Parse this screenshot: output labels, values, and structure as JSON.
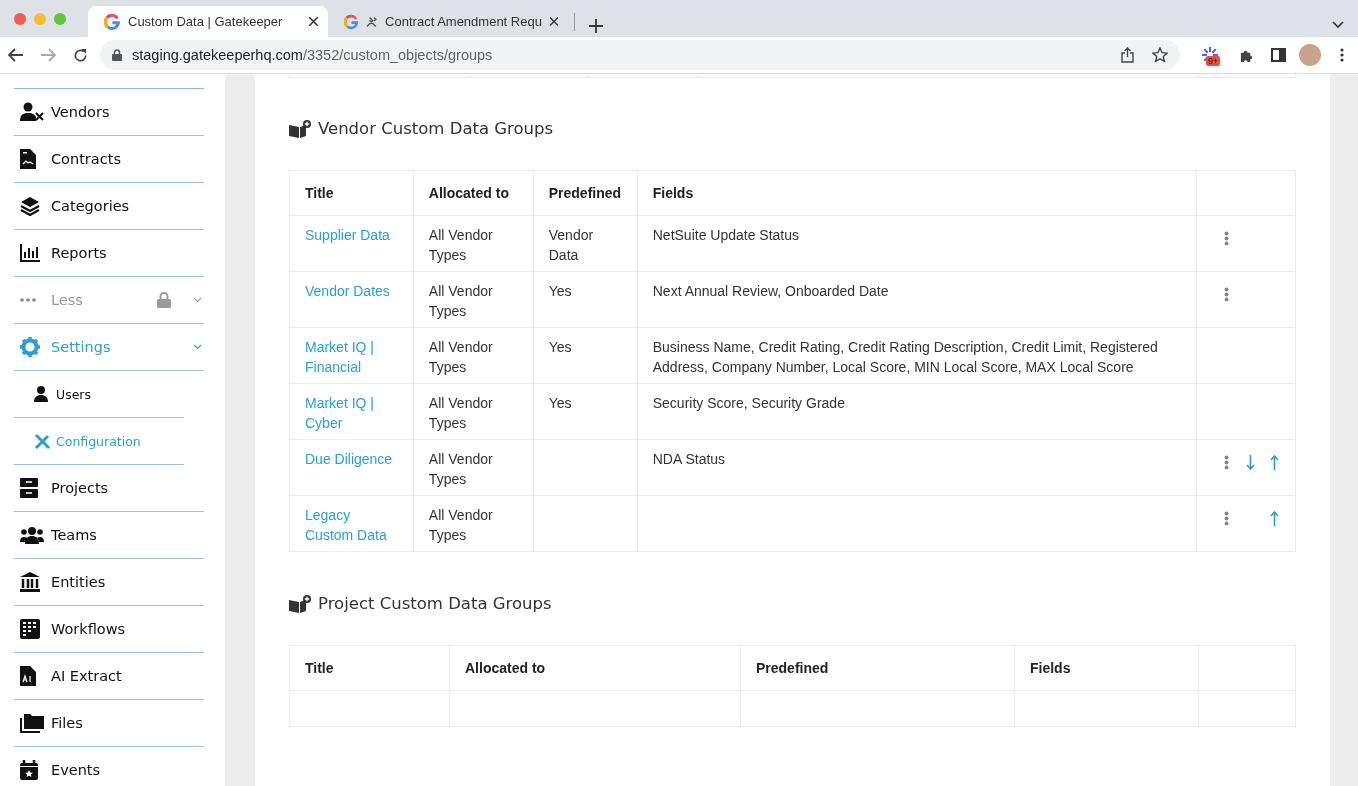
{
  "browser": {
    "tabs": [
      {
        "title": "Custom Data | Gatekeeper",
        "selected": true
      },
      {
        "title": "Contract Amendment Requ",
        "selected": false
      }
    ],
    "url": {
      "host": "staging.gatekeeperhq.com",
      "path": "/3352/custom_objects/groups"
    },
    "extension_badge": "9+"
  },
  "sidebar": {
    "items": [
      {
        "label": "Vendors",
        "kind": "link",
        "selected": false
      },
      {
        "label": "Contracts",
        "kind": "link",
        "selected": false
      },
      {
        "label": "Categories",
        "kind": "link",
        "selected": false
      },
      {
        "label": "Reports",
        "kind": "link",
        "selected": false
      },
      {
        "label": "Less",
        "kind": "group",
        "selected": false,
        "expanded": true,
        "locked": true
      },
      {
        "label": "Settings",
        "kind": "group",
        "selected": true,
        "expanded": true,
        "locked": false
      },
      {
        "label": "Users",
        "kind": "sub",
        "selected": false
      },
      {
        "label": "Configuration",
        "kind": "sub",
        "selected": true
      },
      {
        "label": "Projects",
        "kind": "link",
        "selected": false
      },
      {
        "label": "Teams",
        "kind": "link",
        "selected": false
      },
      {
        "label": "Entities",
        "kind": "link",
        "selected": false
      },
      {
        "label": "Workflows",
        "kind": "link",
        "selected": false
      },
      {
        "label": "AI Extract",
        "kind": "link",
        "selected": false
      },
      {
        "label": "Files",
        "kind": "link",
        "selected": false
      },
      {
        "label": "Events",
        "kind": "link",
        "selected": false
      }
    ]
  },
  "sections": [
    {
      "heading": "Vendor Custom Data Groups",
      "columns": [
        "Title",
        "Allocated to",
        "Predefined",
        "Fields"
      ],
      "rows": [
        {
          "title": "Supplier Data",
          "allocated_to": "All Vendor Types",
          "predefined": "Vendor Data",
          "fields": "NetSuite Update Status",
          "menu": true,
          "move_down": false,
          "move_up": false
        },
        {
          "title": "Vendor Dates",
          "allocated_to": "All Vendor Types",
          "predefined": "Yes",
          "fields": "Next Annual Review, Onboarded Date",
          "menu": true,
          "move_down": false,
          "move_up": false
        },
        {
          "title": "Market IQ | Financial",
          "allocated_to": "All Vendor Types",
          "predefined": "Yes",
          "fields": "Business Name, Credit Rating, Credit Rating Description, Credit Limit, Registered Address, Company Number, Local Score, MIN Local Score, MAX Local Score",
          "menu": false,
          "move_down": false,
          "move_up": false
        },
        {
          "title": "Market IQ | Cyber",
          "allocated_to": "All Vendor Types",
          "predefined": "Yes",
          "fields": "Security Score, Security Grade",
          "menu": false,
          "move_down": false,
          "move_up": false
        },
        {
          "title": "Due Diligence",
          "allocated_to": "All Vendor Types",
          "predefined": "",
          "fields": "NDA Status",
          "menu": true,
          "move_down": true,
          "move_up": true
        },
        {
          "title": "Legacy Custom Data",
          "allocated_to": "All Vendor Types",
          "predefined": "",
          "fields": "",
          "menu": true,
          "move_down": false,
          "move_up": true
        }
      ]
    },
    {
      "heading": "Project Custom Data Groups",
      "columns": [
        "Title",
        "Allocated to",
        "Predefined",
        "Fields"
      ]
    }
  ]
}
